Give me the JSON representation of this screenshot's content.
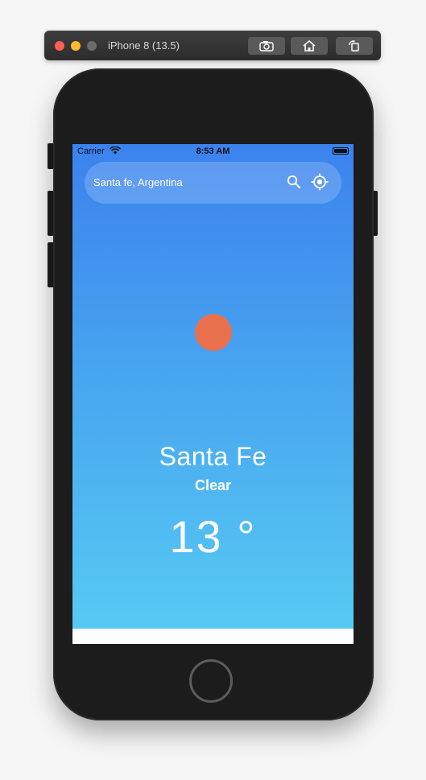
{
  "simulator": {
    "title": "iPhone 8 (13.5)",
    "buttons": [
      "screenshot-icon",
      "home-icon",
      "rotate-icon"
    ]
  },
  "status_bar": {
    "carrier": "Carrier",
    "time": "8:53 AM"
  },
  "search": {
    "text": "Santa fe, Argentina"
  },
  "weather": {
    "city": "Santa Fe",
    "condition": "Clear",
    "temperature": "13 °",
    "icon": "sun-icon"
  },
  "colors": {
    "gradient_top": "#3b82ee",
    "gradient_bottom": "#56caf3",
    "sun": "#e8704d"
  }
}
